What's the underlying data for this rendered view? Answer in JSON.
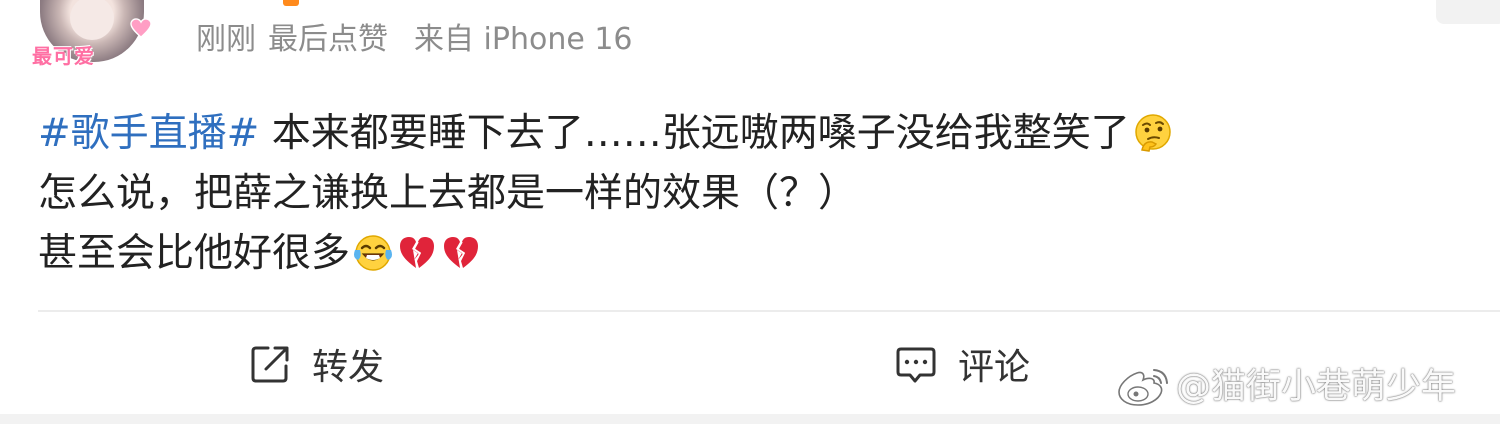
{
  "header": {
    "time": "刚刚",
    "last_liked": "最后点赞",
    "source": "来自 iPhone 16",
    "avatar_sticker": "最可爱"
  },
  "post": {
    "topic": "#歌手直播#",
    "line1": " 本来都要睡下去了……张远嗷两嗓子没给我整笑了",
    "line2": "怎么说，把薛之谦换上去都是一样的效果（？）",
    "line3": "甚至会比他好很多",
    "emojis": [
      "thinking-emoji",
      "laugh-cry-emoji",
      "broken-heart-emoji",
      "broken-heart-emoji"
    ]
  },
  "actions": {
    "repost": "转发",
    "comment": "评论"
  },
  "watermark": {
    "text": "@猫街小巷萌少年"
  },
  "colors": {
    "topic": "#2f6fbf",
    "meta": "#8c8c8c",
    "text": "#222222",
    "divider": "#ececec",
    "broken_heart": "#e0243a"
  }
}
